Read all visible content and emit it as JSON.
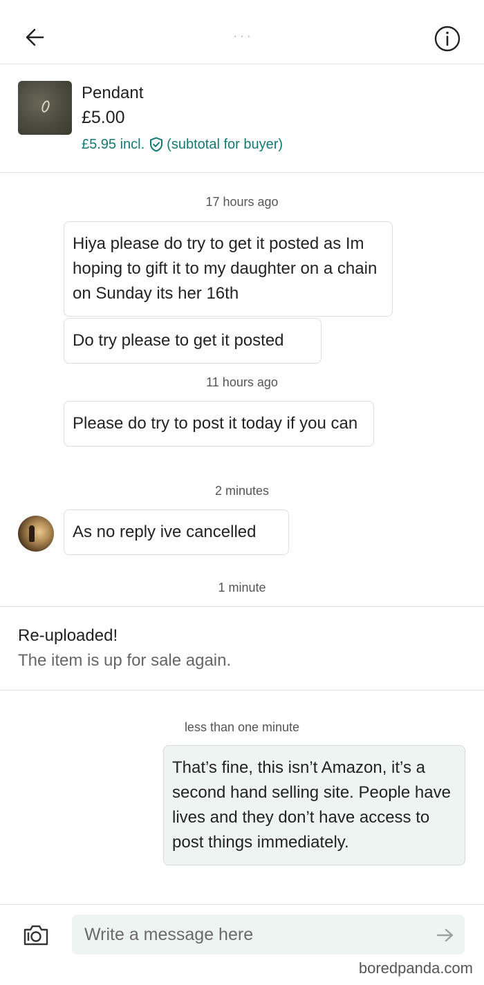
{
  "header": {
    "user_name": "· · ·",
    "back_icon": "arrow-left-icon",
    "info_icon": "info-circle-icon"
  },
  "item": {
    "title": "Pendant",
    "price": "£5.00",
    "buyer_price": "£5.95 incl.",
    "buyer_note": "(subtotal for buyer)",
    "accent_color": "#117a74"
  },
  "messages": {
    "ts_1": "17 hours ago",
    "msg_1": "Hiya please do try to get it posted as Im hoping to gift it to my daughter on a chain on Sunday its her 16th",
    "msg_2": "Do try please to get it posted",
    "ts_2": "11 hours ago",
    "msg_3": "Please do try to post it today if you can",
    "ts_3": "2 minutes",
    "msg_4": "As no reply ive cancelled",
    "ts_4": "1 minute",
    "ts_5": "less than one minute",
    "msg_5": "That’s fine, this isn’t Amazon, it’s a second hand selling site. People have lives and they don’t have access to post things immediately."
  },
  "system": {
    "title": "Re-uploaded!",
    "description": "The item is up for sale again."
  },
  "composer": {
    "placeholder": "Write a message here",
    "camera_icon": "camera-icon",
    "send_icon": "send-arrow-icon"
  },
  "watermark": "boredpanda.com"
}
